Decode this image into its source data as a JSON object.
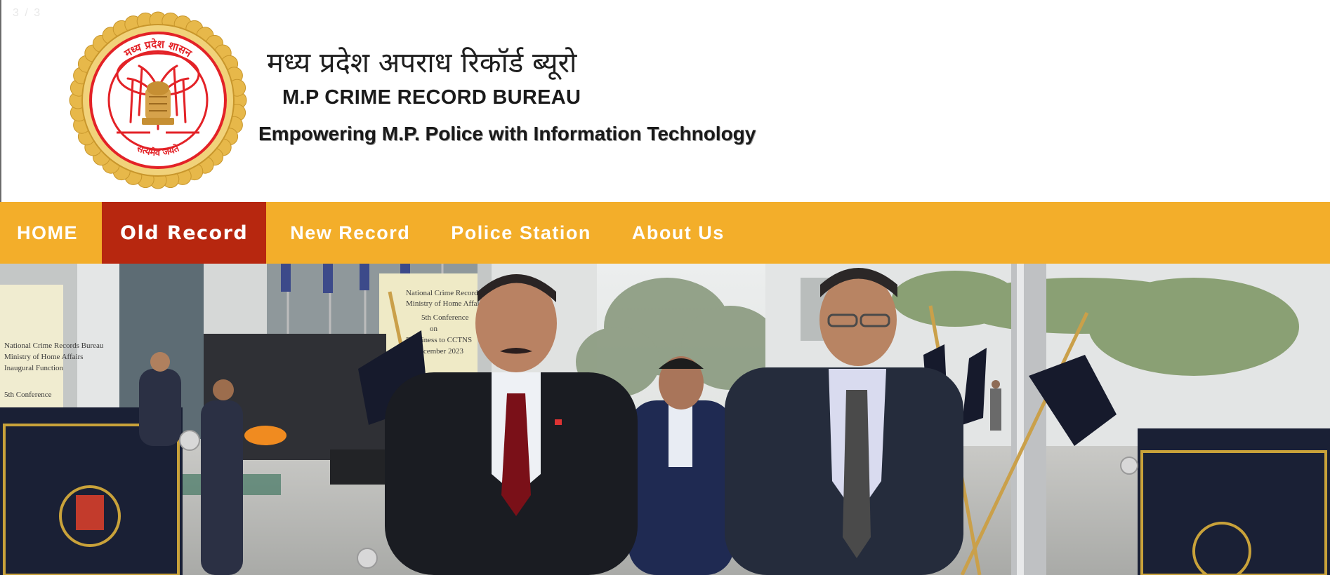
{
  "slide_counter": "3 / 3",
  "header": {
    "title_hindi": "मध्य प्रदेश अपराध रिकॉर्ड ब्यूरो",
    "title_english": "M.P CRIME RECORD BUREAU",
    "tagline": "Empowering M.P. Police with Information Technology",
    "seal": {
      "top_text": "मध्य प्रदेश शासन",
      "bottom_text": "सत्यमेव जयते"
    }
  },
  "nav": {
    "items": [
      {
        "label": "HOME",
        "active": false
      },
      {
        "label": "Old Record",
        "active": true
      },
      {
        "label": "New Record",
        "active": false
      },
      {
        "label": "Police Station",
        "active": false
      },
      {
        "label": "About Us",
        "active": false
      }
    ]
  },
  "hero": {
    "banner_left_lines": [
      "National Crime Records Bureau",
      "Ministry of Home Affairs",
      "Inaugural Function",
      "5th Conference"
    ],
    "banner_center_lines": [
      "National Crime Records Bureau",
      "Ministry of Home Affairs",
      "5th Conference",
      "on",
      "Readiness to CCTNS",
      "December 2023"
    ]
  },
  "colors": {
    "nav_background": "#f3ae2a",
    "nav_active": "#b7270f",
    "seal_red": "#e32227",
    "seal_gold": "#d9a63a"
  }
}
